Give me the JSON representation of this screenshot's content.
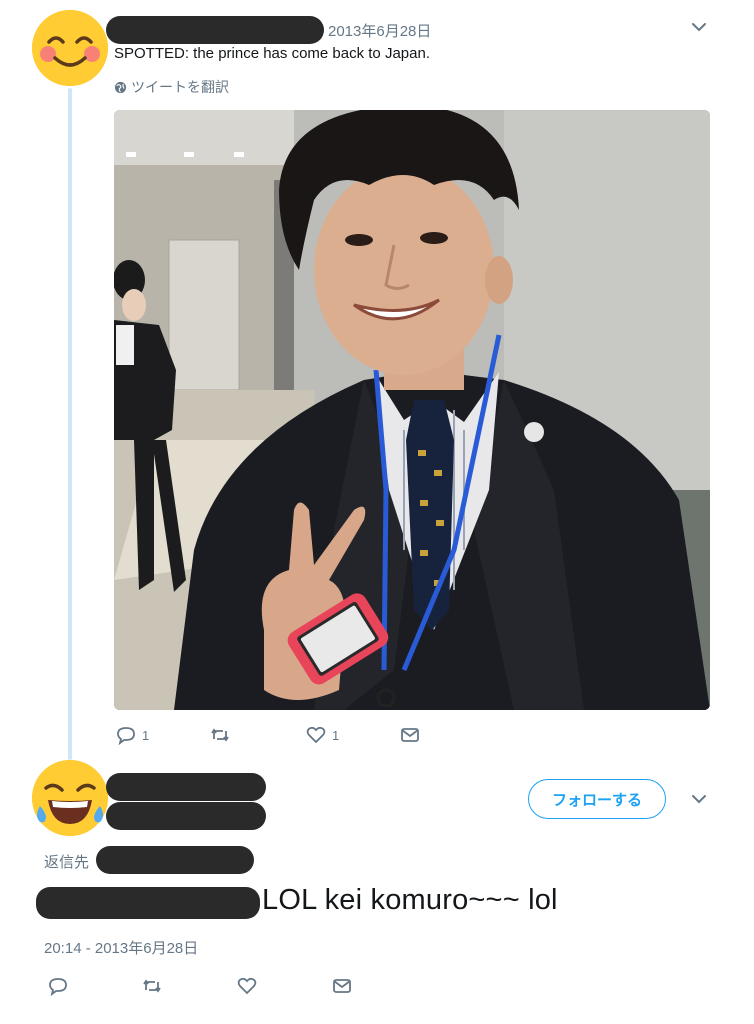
{
  "tweet1": {
    "date": "2013年6月28日",
    "text": "SPOTTED: the prince has come back to Japan.",
    "translate_label": "ツイートを翻訳",
    "reply_count": "1",
    "like_count": "1",
    "avatar_icon": "smiling-blush-emoji-icon"
  },
  "tweet2": {
    "follow_label": "フォローする",
    "reply_to_label": "返信先",
    "text": "LOL kei komuro~~~ lol",
    "timestamp": "20:14 - 2013年6月28日",
    "avatar_icon": "tears-of-joy-emoji-icon"
  },
  "colors": {
    "accent": "#1da1f2",
    "muted": "#657786",
    "thread_line": "#cfe6f7"
  }
}
